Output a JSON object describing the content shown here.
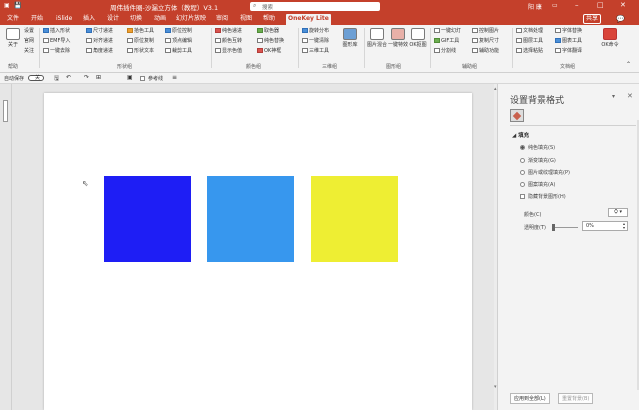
{
  "title_bar": {
    "title": "周伟插件圈-沙漏立方体（教程）V3.1",
    "search_placeholder": "搜索",
    "user": "阳 康",
    "share": "共享"
  },
  "tabs": [
    "文件",
    "开始",
    "iSlide",
    "插入",
    "设计",
    "切换",
    "动画",
    "幻灯片放映",
    "审阅",
    "视图",
    "帮助",
    "OneKey Lite"
  ],
  "active_tab": "OneKey Lite",
  "ribbon": {
    "about": {
      "l1": "关于",
      "l2": "帮助"
    },
    "setup": [
      "设置",
      "官网",
      "关注"
    ],
    "shape_col1": [
      "插入形状",
      "EMF导入",
      "一键去除"
    ],
    "shape_col2": [
      "尺寸递进",
      "对齐递进",
      "角度递进"
    ],
    "shape_col3": [
      "拾色工具",
      "原位复制",
      "形状文本"
    ],
    "shape_col4": [
      "原位控制",
      "顶点编辑",
      "裁剪工具"
    ],
    "group_shape": "形状组",
    "color_col1": [
      "纯色递进",
      "颜色互转",
      "显示色值"
    ],
    "color_col2": [
      "取色器",
      "纯色替换",
      "OK神框"
    ],
    "group_color": "颜色组",
    "three_col": [
      "旋转分布",
      "一键清除",
      "三维工具"
    ],
    "three_big": "图形库",
    "group_three": "三维组",
    "image_bigs": [
      "图片混合",
      "一键特效",
      "OK抠图"
    ],
    "group_image": "图形组",
    "aux_col1": [
      "一键幻灯",
      "GIF工具",
      "分割线"
    ],
    "aux_col2": [
      "控制图片",
      "复制尺寸",
      "辅助功能"
    ],
    "group_aux": "辅助组",
    "doc_col1": [
      "文档处理",
      "图层工具",
      "选择粘贴"
    ],
    "doc_col2": [
      "字体替换",
      "图表工具",
      "字体翻译"
    ],
    "doc_big": "OK命令",
    "group_doc": "文档组"
  },
  "qat": {
    "autosave": "自动保存",
    "toggle": "关",
    "ref_line": "参考线"
  },
  "slide": {
    "squares": [
      {
        "name": "blue-square",
        "color": "#1e1ef5"
      },
      {
        "name": "light-blue-square",
        "color": "#3797ee"
      },
      {
        "name": "yellow-square",
        "color": "#eeee33"
      }
    ]
  },
  "pane": {
    "title": "设置背景格式",
    "section": "填充",
    "options": [
      {
        "label": "纯色填充(S)",
        "selected": true
      },
      {
        "label": "渐变填充(G)",
        "selected": false
      },
      {
        "label": "图片或纹理填充(P)",
        "selected": false
      },
      {
        "label": "图案填充(A)",
        "selected": false
      }
    ],
    "hide_bg": "隐藏背景图形(H)",
    "color_label": "颜色(C)",
    "transparency_label": "透明度(T)",
    "transparency_value": "0%",
    "apply_all": "应用到全部(L)",
    "reset": "重置背景(B)"
  }
}
